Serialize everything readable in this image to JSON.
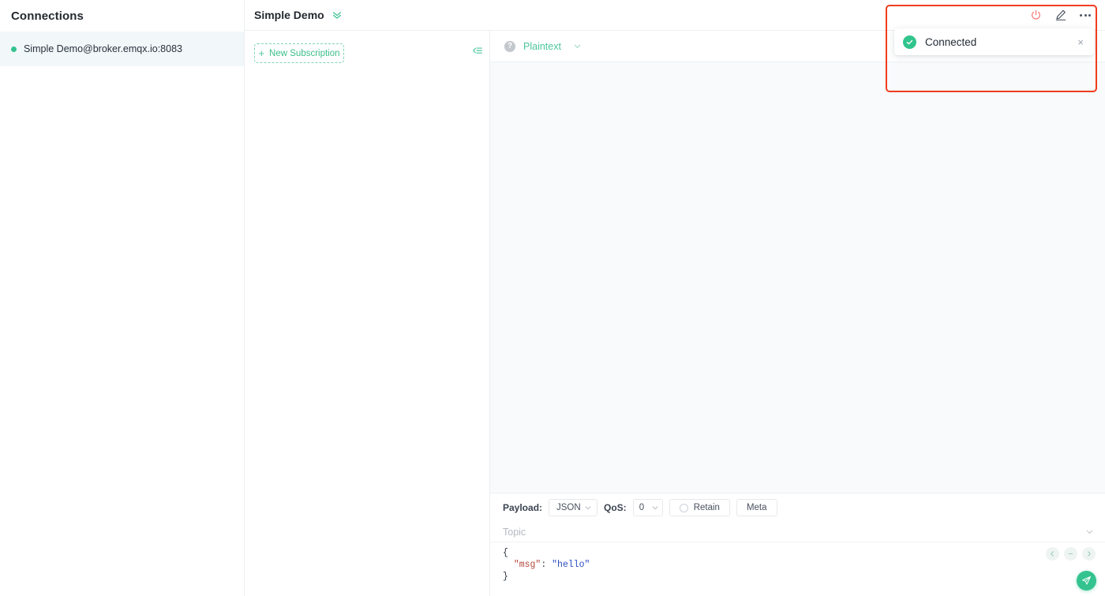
{
  "sidebar": {
    "title": "Connections",
    "connections": [
      {
        "label": "Simple Demo@broker.emqx.io:8083",
        "status_color": "#34c38f"
      }
    ]
  },
  "header": {
    "title": "Simple Demo",
    "actions": {
      "disconnect_icon": "power-icon",
      "edit_icon": "edit-pencil-icon",
      "more_icon": "more-horizontal-icon"
    }
  },
  "subscriptions": {
    "new_subscription_label": "New Subscription",
    "plus_glyph": "+",
    "collapse_icon": "collapse-panel-icon"
  },
  "messages": {
    "help_glyph": "?",
    "format_label": "Plaintext",
    "items": []
  },
  "composer": {
    "payload_label": "Payload:",
    "payload_value": "JSON",
    "qos_label": "QoS:",
    "qos_value": "0",
    "retain_label": "Retain",
    "meta_label": "Meta",
    "topic_placeholder": "Topic",
    "topic_value": "",
    "payload": {
      "line1": "{",
      "key": "\"msg\"",
      "colon": ": ",
      "value": "\"hello\"",
      "line3": "}"
    },
    "nav": {
      "prev_icon": "arrow-left-icon",
      "minus_icon": "minus-icon",
      "next_icon": "arrow-right-icon"
    },
    "send_icon": "send-plane-icon"
  },
  "toast": {
    "message": "Connected",
    "status_color": "#31c48d",
    "close_glyph": "×"
  },
  "annotation": {
    "color": "#f03c1e"
  }
}
